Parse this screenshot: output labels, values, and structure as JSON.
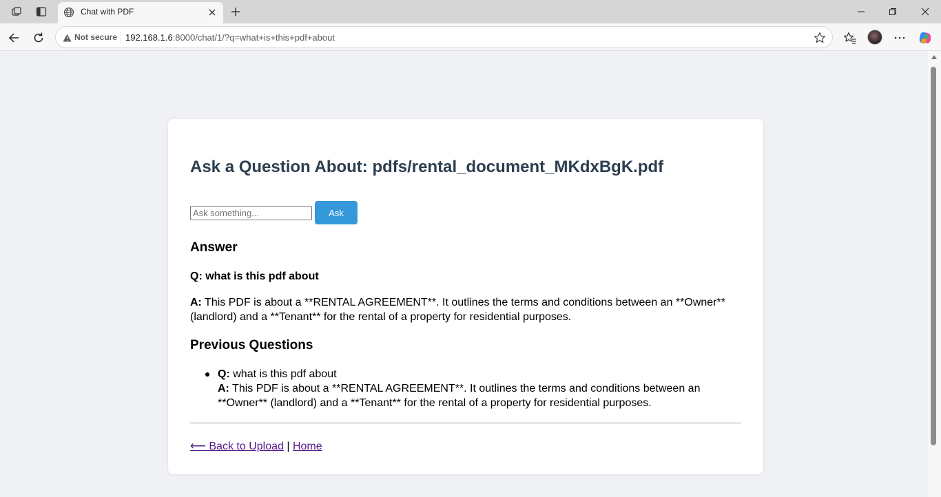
{
  "browser": {
    "tab_title": "Chat with PDF",
    "security_label": "Not secure",
    "url_host": "192.168.1.6",
    "url_rest": ":8000/chat/1/?q=what+is+this+pdf+about"
  },
  "page": {
    "heading": "Ask a Question About: pdfs/rental_document_MKdxBgK.pdf",
    "input_placeholder": "Ask something...",
    "ask_button": "Ask",
    "answer_heading": "Answer",
    "q_label": "Q:",
    "a_label": "A:",
    "question": "what is this pdf about",
    "answer": "This PDF is about a **RENTAL AGREEMENT**. It outlines the terms and conditions between an **Owner** (landlord) and a **Tenant** for the rental of a property for residential purposes.",
    "previous_heading": "Previous Questions",
    "previous": [
      {
        "question": "what is this pdf about",
        "answer": "This PDF is about a **RENTAL AGREEMENT**. It outlines the terms and conditions between an **Owner** (landlord) and a **Tenant** for the rental of a property for residential purposes."
      }
    ],
    "back_link": "⟵ Back to Upload",
    "separator": "|",
    "home_link": "Home"
  }
}
